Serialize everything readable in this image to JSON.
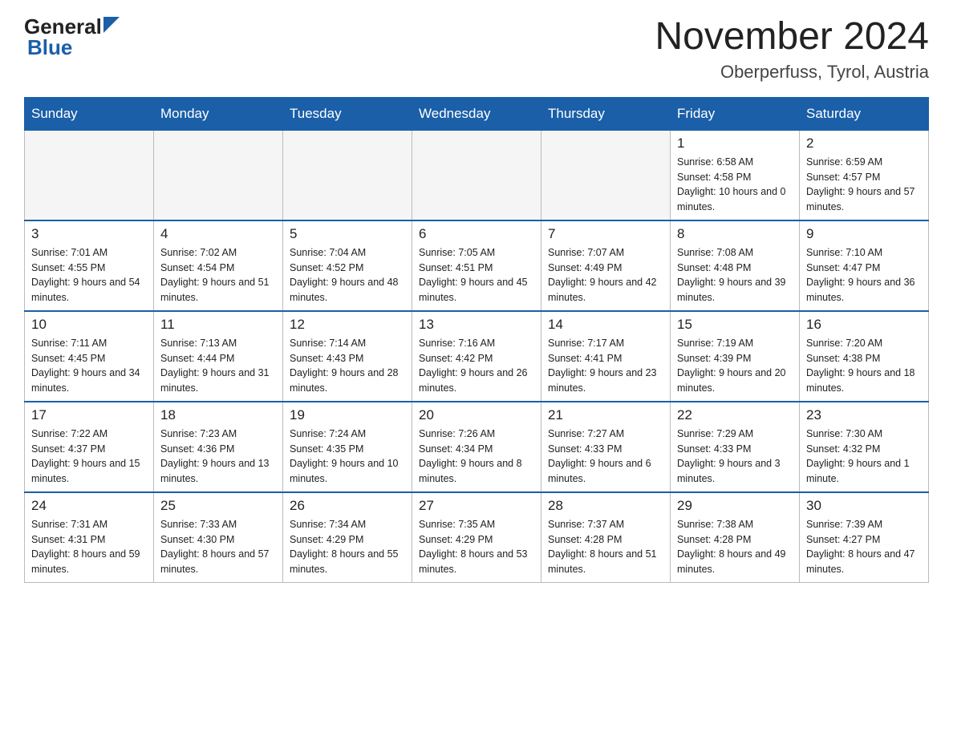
{
  "header": {
    "logo_general": "General",
    "logo_blue": "Blue",
    "title": "November 2024",
    "subtitle": "Oberperfuss, Tyrol, Austria"
  },
  "weekdays": [
    "Sunday",
    "Monday",
    "Tuesday",
    "Wednesday",
    "Thursday",
    "Friday",
    "Saturday"
  ],
  "weeks": [
    [
      {
        "day": "",
        "empty": true
      },
      {
        "day": "",
        "empty": true
      },
      {
        "day": "",
        "empty": true
      },
      {
        "day": "",
        "empty": true
      },
      {
        "day": "",
        "empty": true
      },
      {
        "day": "1",
        "sunrise": "Sunrise: 6:58 AM",
        "sunset": "Sunset: 4:58 PM",
        "daylight": "Daylight: 10 hours and 0 minutes."
      },
      {
        "day": "2",
        "sunrise": "Sunrise: 6:59 AM",
        "sunset": "Sunset: 4:57 PM",
        "daylight": "Daylight: 9 hours and 57 minutes."
      }
    ],
    [
      {
        "day": "3",
        "sunrise": "Sunrise: 7:01 AM",
        "sunset": "Sunset: 4:55 PM",
        "daylight": "Daylight: 9 hours and 54 minutes."
      },
      {
        "day": "4",
        "sunrise": "Sunrise: 7:02 AM",
        "sunset": "Sunset: 4:54 PM",
        "daylight": "Daylight: 9 hours and 51 minutes."
      },
      {
        "day": "5",
        "sunrise": "Sunrise: 7:04 AM",
        "sunset": "Sunset: 4:52 PM",
        "daylight": "Daylight: 9 hours and 48 minutes."
      },
      {
        "day": "6",
        "sunrise": "Sunrise: 7:05 AM",
        "sunset": "Sunset: 4:51 PM",
        "daylight": "Daylight: 9 hours and 45 minutes."
      },
      {
        "day": "7",
        "sunrise": "Sunrise: 7:07 AM",
        "sunset": "Sunset: 4:49 PM",
        "daylight": "Daylight: 9 hours and 42 minutes."
      },
      {
        "day": "8",
        "sunrise": "Sunrise: 7:08 AM",
        "sunset": "Sunset: 4:48 PM",
        "daylight": "Daylight: 9 hours and 39 minutes."
      },
      {
        "day": "9",
        "sunrise": "Sunrise: 7:10 AM",
        "sunset": "Sunset: 4:47 PM",
        "daylight": "Daylight: 9 hours and 36 minutes."
      }
    ],
    [
      {
        "day": "10",
        "sunrise": "Sunrise: 7:11 AM",
        "sunset": "Sunset: 4:45 PM",
        "daylight": "Daylight: 9 hours and 34 minutes."
      },
      {
        "day": "11",
        "sunrise": "Sunrise: 7:13 AM",
        "sunset": "Sunset: 4:44 PM",
        "daylight": "Daylight: 9 hours and 31 minutes."
      },
      {
        "day": "12",
        "sunrise": "Sunrise: 7:14 AM",
        "sunset": "Sunset: 4:43 PM",
        "daylight": "Daylight: 9 hours and 28 minutes."
      },
      {
        "day": "13",
        "sunrise": "Sunrise: 7:16 AM",
        "sunset": "Sunset: 4:42 PM",
        "daylight": "Daylight: 9 hours and 26 minutes."
      },
      {
        "day": "14",
        "sunrise": "Sunrise: 7:17 AM",
        "sunset": "Sunset: 4:41 PM",
        "daylight": "Daylight: 9 hours and 23 minutes."
      },
      {
        "day": "15",
        "sunrise": "Sunrise: 7:19 AM",
        "sunset": "Sunset: 4:39 PM",
        "daylight": "Daylight: 9 hours and 20 minutes."
      },
      {
        "day": "16",
        "sunrise": "Sunrise: 7:20 AM",
        "sunset": "Sunset: 4:38 PM",
        "daylight": "Daylight: 9 hours and 18 minutes."
      }
    ],
    [
      {
        "day": "17",
        "sunrise": "Sunrise: 7:22 AM",
        "sunset": "Sunset: 4:37 PM",
        "daylight": "Daylight: 9 hours and 15 minutes."
      },
      {
        "day": "18",
        "sunrise": "Sunrise: 7:23 AM",
        "sunset": "Sunset: 4:36 PM",
        "daylight": "Daylight: 9 hours and 13 minutes."
      },
      {
        "day": "19",
        "sunrise": "Sunrise: 7:24 AM",
        "sunset": "Sunset: 4:35 PM",
        "daylight": "Daylight: 9 hours and 10 minutes."
      },
      {
        "day": "20",
        "sunrise": "Sunrise: 7:26 AM",
        "sunset": "Sunset: 4:34 PM",
        "daylight": "Daylight: 9 hours and 8 minutes."
      },
      {
        "day": "21",
        "sunrise": "Sunrise: 7:27 AM",
        "sunset": "Sunset: 4:33 PM",
        "daylight": "Daylight: 9 hours and 6 minutes."
      },
      {
        "day": "22",
        "sunrise": "Sunrise: 7:29 AM",
        "sunset": "Sunset: 4:33 PM",
        "daylight": "Daylight: 9 hours and 3 minutes."
      },
      {
        "day": "23",
        "sunrise": "Sunrise: 7:30 AM",
        "sunset": "Sunset: 4:32 PM",
        "daylight": "Daylight: 9 hours and 1 minute."
      }
    ],
    [
      {
        "day": "24",
        "sunrise": "Sunrise: 7:31 AM",
        "sunset": "Sunset: 4:31 PM",
        "daylight": "Daylight: 8 hours and 59 minutes."
      },
      {
        "day": "25",
        "sunrise": "Sunrise: 7:33 AM",
        "sunset": "Sunset: 4:30 PM",
        "daylight": "Daylight: 8 hours and 57 minutes."
      },
      {
        "day": "26",
        "sunrise": "Sunrise: 7:34 AM",
        "sunset": "Sunset: 4:29 PM",
        "daylight": "Daylight: 8 hours and 55 minutes."
      },
      {
        "day": "27",
        "sunrise": "Sunrise: 7:35 AM",
        "sunset": "Sunset: 4:29 PM",
        "daylight": "Daylight: 8 hours and 53 minutes."
      },
      {
        "day": "28",
        "sunrise": "Sunrise: 7:37 AM",
        "sunset": "Sunset: 4:28 PM",
        "daylight": "Daylight: 8 hours and 51 minutes."
      },
      {
        "day": "29",
        "sunrise": "Sunrise: 7:38 AM",
        "sunset": "Sunset: 4:28 PM",
        "daylight": "Daylight: 8 hours and 49 minutes."
      },
      {
        "day": "30",
        "sunrise": "Sunrise: 7:39 AM",
        "sunset": "Sunset: 4:27 PM",
        "daylight": "Daylight: 8 hours and 47 minutes."
      }
    ]
  ]
}
